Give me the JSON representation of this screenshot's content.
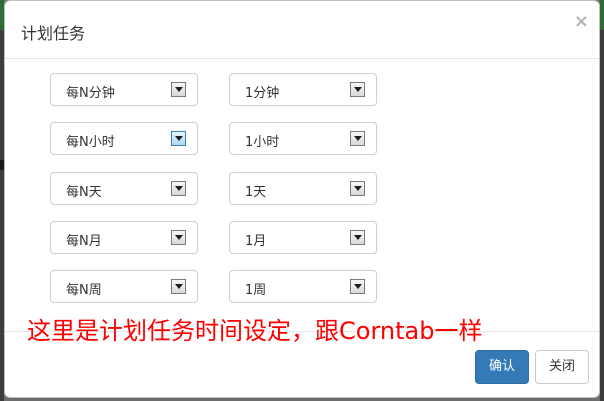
{
  "dialog": {
    "title": "计划任务",
    "close_symbol": "×"
  },
  "schedule_rows": [
    {
      "unit": "每N分钟",
      "value": "1分钟"
    },
    {
      "unit": "每N小时",
      "value": "1小时"
    },
    {
      "unit": "每N天",
      "value": "1天"
    },
    {
      "unit": "每N月",
      "value": "1月"
    },
    {
      "unit": "每N周",
      "value": "1周"
    }
  ],
  "annotation": "这里是计划任务时间设定，跟Corntab一样",
  "footer": {
    "confirm_label": "确认",
    "close_label": "关闭"
  },
  "colors": {
    "primary": "#337ab7",
    "annotation": "#ff0000"
  }
}
